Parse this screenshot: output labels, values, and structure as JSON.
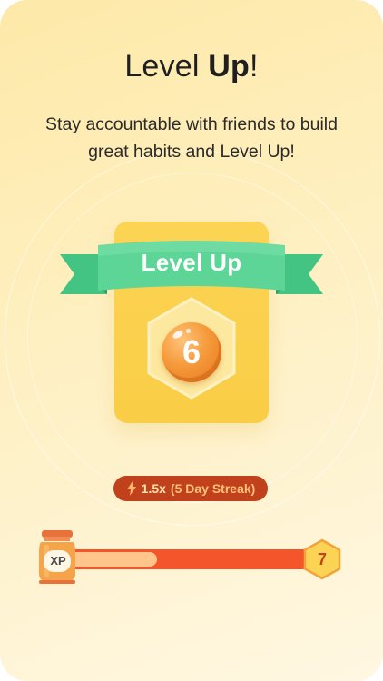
{
  "header": {
    "title_regular": "Level ",
    "title_bold": "Up",
    "title_suffix": "!",
    "subtitle": "Stay accountable with friends to build great habits and Level Up!"
  },
  "badge": {
    "ribbon_label": "Level Up",
    "level": "6"
  },
  "streak": {
    "multiplier": "1.5x",
    "days_label": "(5 Day Streak)"
  },
  "xp": {
    "label": "XP",
    "progress_fraction": 0.37,
    "next_level": "7"
  },
  "colors": {
    "background": "#fde9a8",
    "card": "#fcd455",
    "ribbon": "#5cd596",
    "coin": "#f59a3a",
    "streak_pill": "#c0411c",
    "progress_track": "#f5552b",
    "progress_fill": "#ffc58b"
  },
  "icons": {
    "streak": "lightning-bolt-icon",
    "xp": "xp-jar-icon",
    "next_level": "hexagon-icon"
  }
}
